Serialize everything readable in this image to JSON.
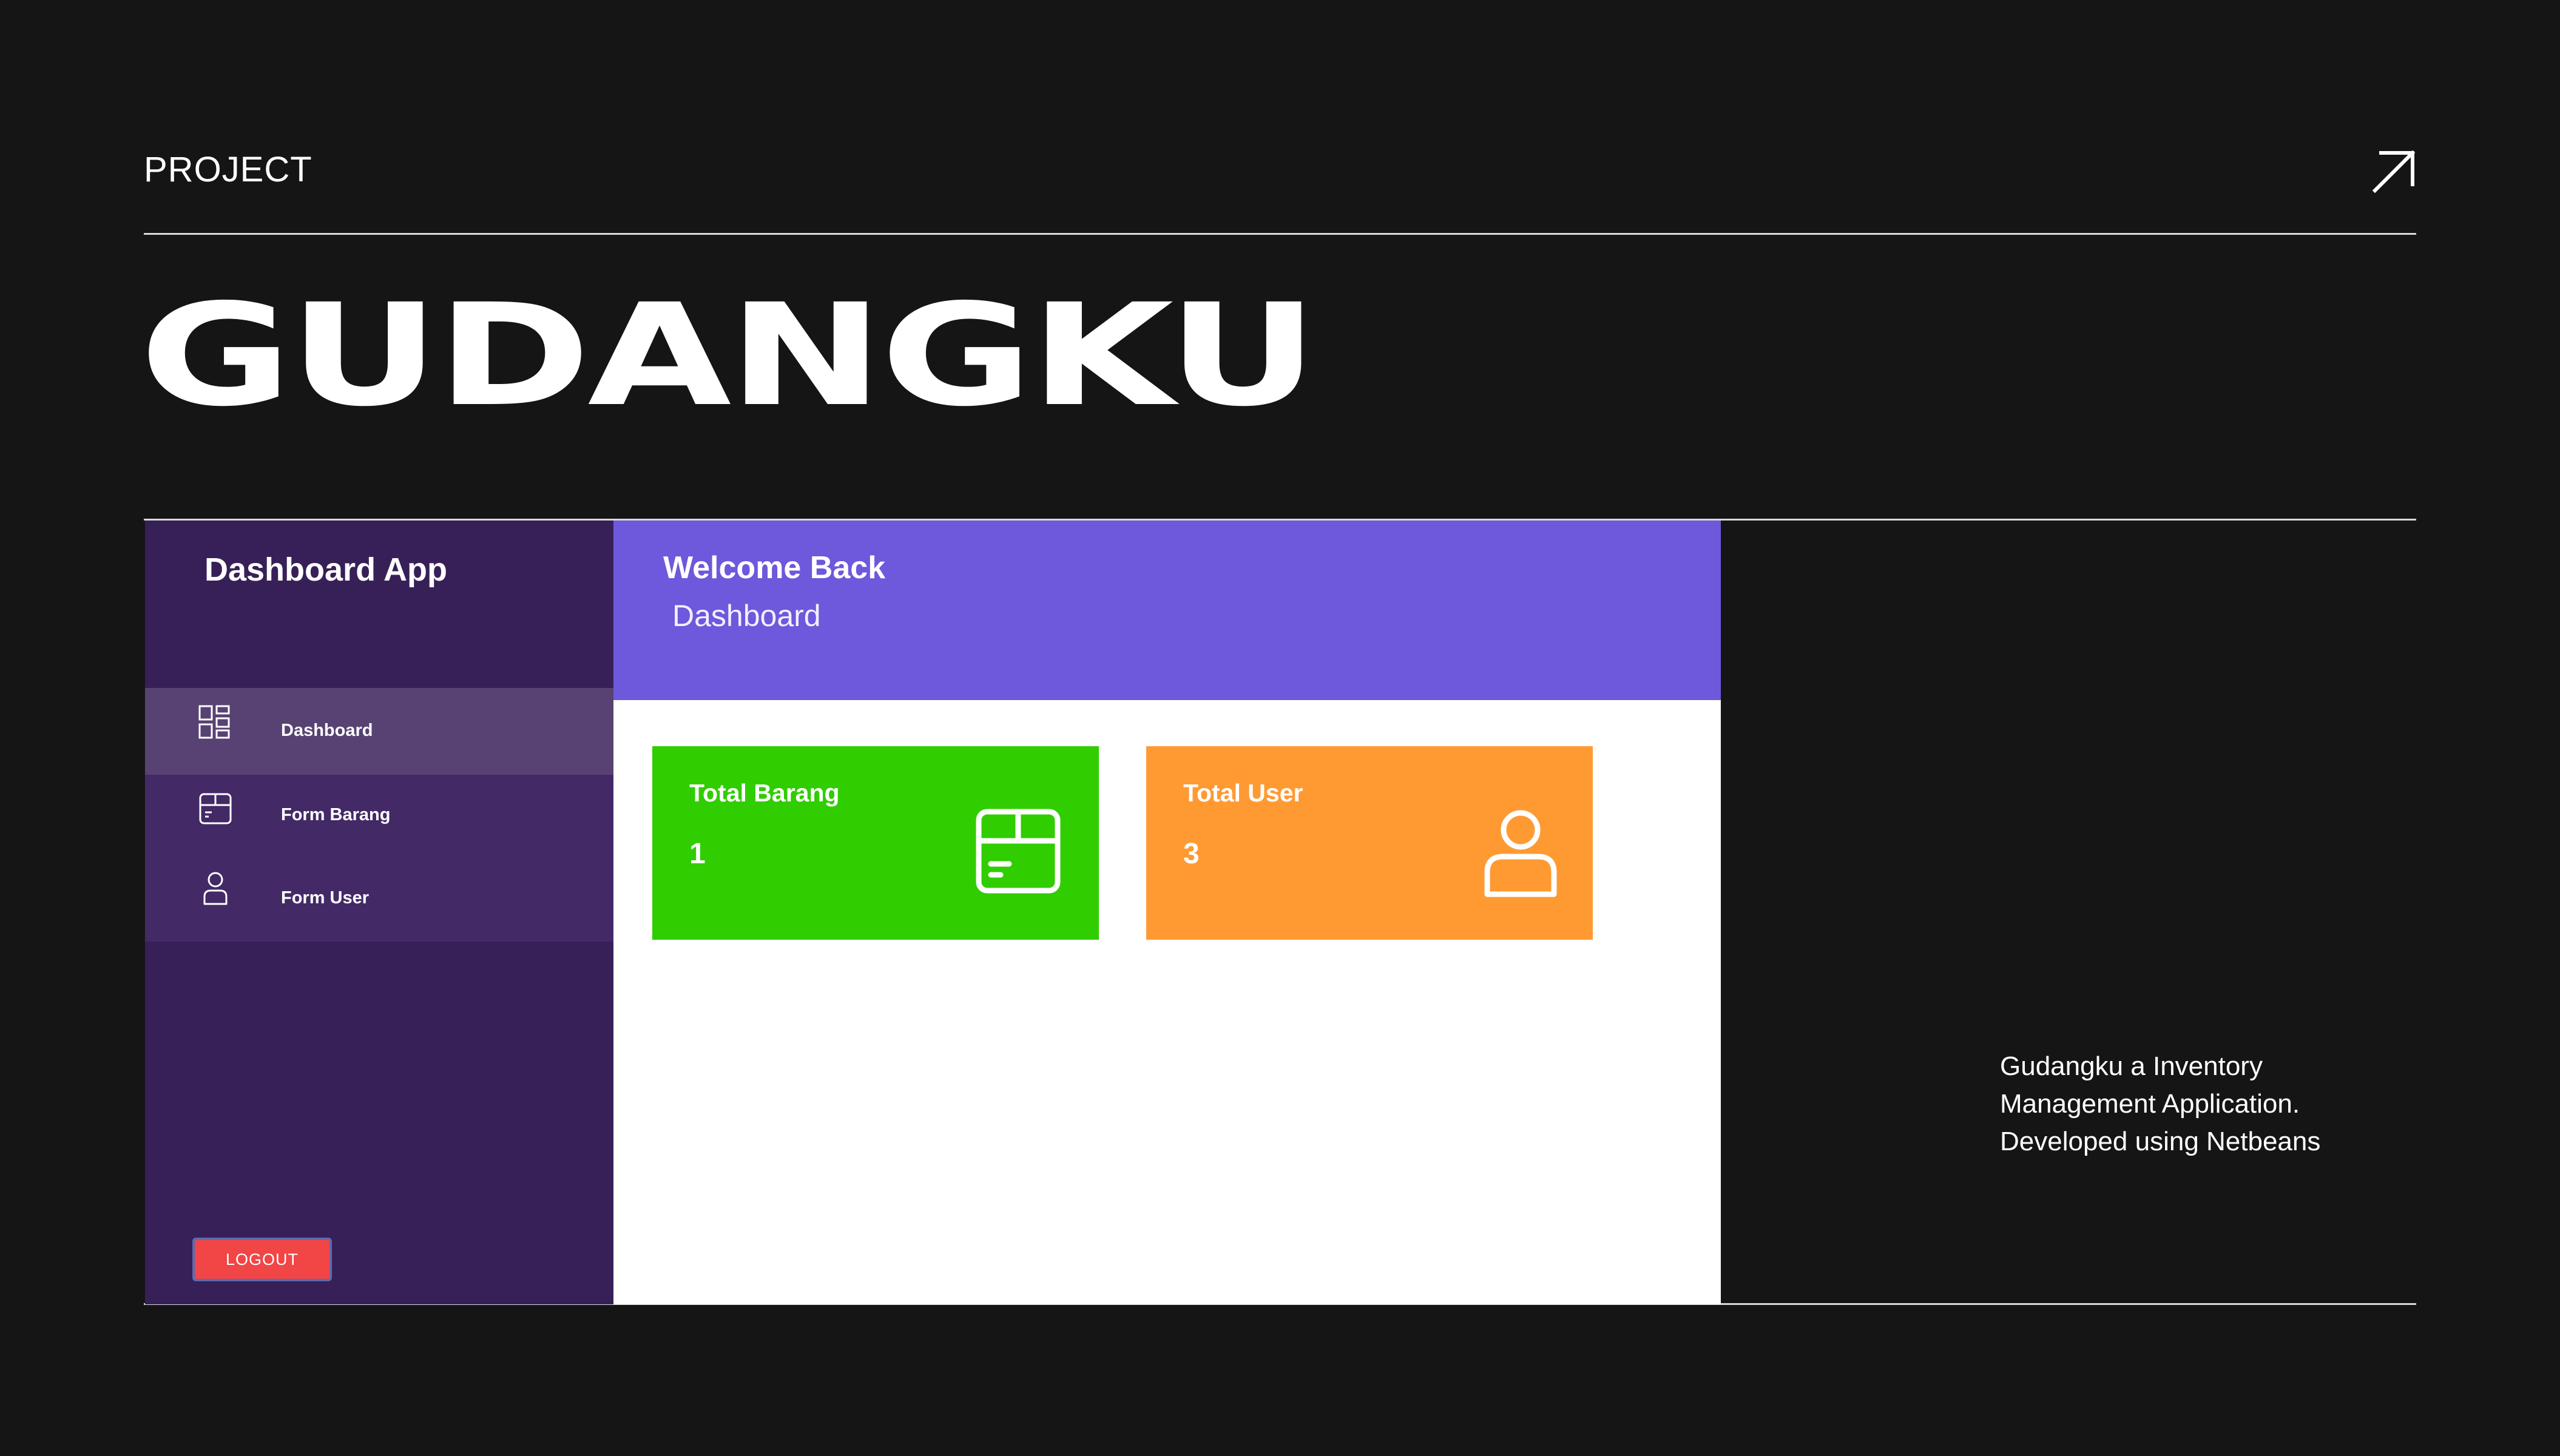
{
  "header": {
    "kicker": "PROJECT",
    "title": "GUDANGKU"
  },
  "app": {
    "name": "Dashboard App",
    "nav": [
      {
        "label": "Dashboard",
        "icon": "grid-icon",
        "active": true
      },
      {
        "label": "Form Barang",
        "icon": "package-icon",
        "active": false
      },
      {
        "label": "Form User",
        "icon": "user-icon",
        "active": false
      }
    ],
    "logout_label": "LOGOUT",
    "topbar": {
      "welcome": "Welcome Back",
      "page": "Dashboard"
    },
    "cards": [
      {
        "label": "Total Barang",
        "value": "1",
        "icon": "box-icon",
        "color": "#30cd00"
      },
      {
        "label": "Total User",
        "value": "3",
        "icon": "user-icon",
        "color": "#ff9a33"
      }
    ],
    "colors": {
      "sidebar": "#372058",
      "nav_bg": "#432a66",
      "nav_active": "#574273",
      "topbar": "#6e58dc",
      "logout": "#f24545"
    }
  },
  "description": {
    "line1": "Gudangku a Inventory",
    "line2": "Management Application.",
    "line3": "Developed using Netbeans"
  }
}
